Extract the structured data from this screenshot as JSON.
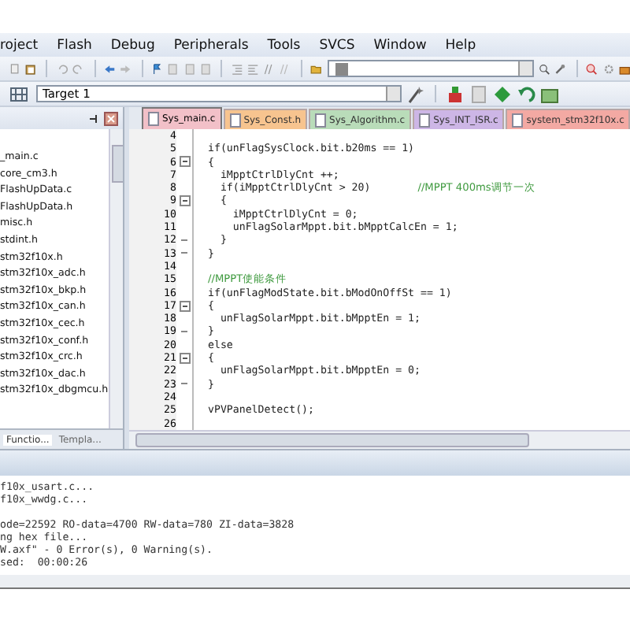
{
  "menu_bar": [
    "roject",
    "Flash",
    "Debug",
    "Peripherals",
    "Tools",
    "SVCS",
    "Window",
    "Help"
  ],
  "target_select": {
    "value": "Target 1"
  },
  "editor_tabs": [
    {
      "label": "Sys_main.c",
      "color": "#f2c0c8",
      "selected": true
    },
    {
      "label": "Sys_Const.h",
      "color": "#f7c48f",
      "selected": false
    },
    {
      "label": "Sys_Algorithm.c",
      "color": "#b9dcb9",
      "selected": false
    },
    {
      "label": "Sys_INT_ISR.c",
      "color": "#cdb6e6",
      "selected": false
    },
    {
      "label": "system_stm32f10x.c",
      "color": "#f3a9a3",
      "selected": false
    }
  ],
  "project_files": [
    "_main.c",
    "core_cm3.h",
    "FlashUpData.c",
    "FlashUpData.h",
    "misc.h",
    "stdint.h",
    "stm32f10x.h",
    "stm32f10x_adc.h",
    "stm32f10x_bkp.h",
    "stm32f10x_can.h",
    "stm32f10x_cec.h",
    "stm32f10x_conf.h",
    "stm32f10x_crc.h",
    "stm32f10x_dac.h",
    "stm32f10x_dbgmcu.h"
  ],
  "panel_tabs": [
    {
      "label": "Functio...",
      "selected": true
    },
    {
      "label": "Templa...",
      "selected": false
    }
  ],
  "code_lines": [
    {
      "number": "4"
    },
    {
      "number": "5",
      "code": "if(unFlagSysClock.bit.b20ms == 1)"
    },
    {
      "number": "6",
      "code": "{",
      "fold_open": true
    },
    {
      "number": "7",
      "code": "  iMpptCtrlDlyCnt ++;"
    },
    {
      "number": "8",
      "code": "  if(iMpptCtrlDlyCnt > 20)",
      "comment": "//MPPT 400ms调节一次"
    },
    {
      "number": "9",
      "code": "  {",
      "fold_open": true
    },
    {
      "number": "10",
      "code": "    iMpptCtrlDlyCnt = 0;"
    },
    {
      "number": "11",
      "code": "    unFlagSolarMppt.bit.bMpptCalcEn = 1;"
    },
    {
      "number": "12",
      "code": "  }",
      "fold_end": true
    },
    {
      "number": "13",
      "code": "}",
      "fold_end": true
    },
    {
      "number": "14"
    },
    {
      "number": "15",
      "comment": "//MPPT使能条件"
    },
    {
      "number": "16",
      "code": "if(unFlagModState.bit.bModOnOffSt == 1)"
    },
    {
      "number": "17",
      "code": "{",
      "fold_open": true
    },
    {
      "number": "18",
      "code": "  unFlagSolarMppt.bit.bMpptEn = 1;"
    },
    {
      "number": "19",
      "code": "}",
      "fold_end": true
    },
    {
      "number": "20",
      "code": "else"
    },
    {
      "number": "21",
      "code": "{",
      "fold_open": true
    },
    {
      "number": "22",
      "code": "  unFlagSolarMppt.bit.bMpptEn = 0;"
    },
    {
      "number": "23",
      "code": "}",
      "fold_end": true
    },
    {
      "number": "24"
    },
    {
      "number": "25",
      "code": "vPVPanelDetect();"
    },
    {
      "number": "26"
    }
  ],
  "build_output": [
    {
      "text": "f10x_usart.c..."
    },
    {
      "text": "f10x_wwdg.c..."
    },
    {
      "text": "ode=22592 RO-data=4700 RW-data=780 ZI-data=3828",
      "blank_before": true
    },
    {
      "text": "ng hex file..."
    },
    {
      "text": "W.axf\" - 0 Error(s), 0 Warning(s)."
    },
    {
      "text": "sed:  00:00:26"
    }
  ]
}
